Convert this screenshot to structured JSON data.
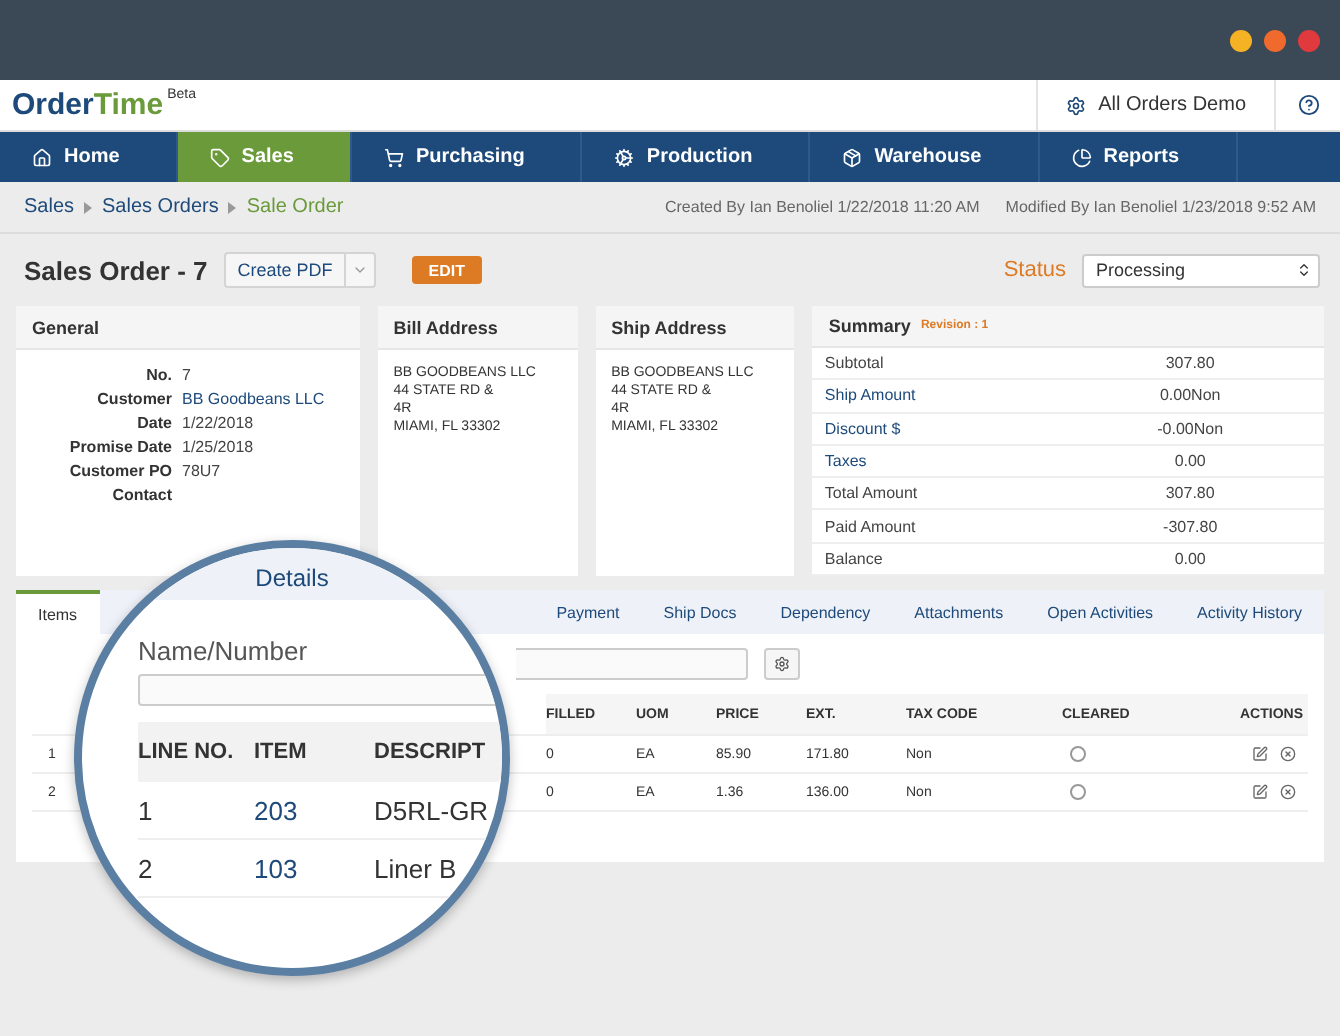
{
  "header": {
    "logo_prefix": "Order",
    "logo_suffix": "Time",
    "logo_badge": "Beta",
    "account": "All Orders Demo"
  },
  "nav": [
    {
      "label": "Home",
      "selected": false
    },
    {
      "label": "Sales",
      "selected": true
    },
    {
      "label": "Purchasing",
      "selected": false
    },
    {
      "label": "Production",
      "selected": false
    },
    {
      "label": "Warehouse",
      "selected": false
    },
    {
      "label": "Reports",
      "selected": false
    }
  ],
  "breadcrumb": [
    "Sales",
    "Sales Orders",
    "Sale Order"
  ],
  "created": "Created By Ian Benoliel 1/22/2018 11:20 AM",
  "modified": "Modified By Ian Benoliel 1/23/2018 9:52 AM",
  "title": "Sales Order - 7",
  "create_pdf": "Create PDF",
  "edit": "EDIT",
  "status_label": "Status",
  "status_value": "Processing",
  "general": {
    "title": "General",
    "fields": [
      {
        "label": "No.",
        "value": "7",
        "kind": "text"
      },
      {
        "label": "Customer",
        "value": "BB Goodbeans LLC",
        "kind": "link"
      },
      {
        "label": "Date",
        "value": "1/22/2018",
        "kind": "text"
      },
      {
        "label": "Promise Date",
        "value": "1/25/2018",
        "kind": "text"
      },
      {
        "label": "Customer PO",
        "value": "78U7",
        "kind": "text"
      },
      {
        "label": "Contact"
      }
    ]
  },
  "bill_address": {
    "title": "Bill Address",
    "lines": [
      "BB GOODBEANS LLC",
      "44 STATE RD &",
      "4R",
      "MIAMI, FL 33302"
    ]
  },
  "ship_address": {
    "title": "Ship Address",
    "lines": [
      "BB GOODBEANS LLC",
      "44 STATE RD &",
      "4R",
      "MIAMI, FL 33302"
    ]
  },
  "summary": {
    "title": "Summary",
    "revision": "Revision : 1",
    "rows": [
      {
        "label": "Subtotal",
        "value": "307.80",
        "link": false
      },
      {
        "label": "Ship Amount",
        "value": "0.00Non",
        "link": true
      },
      {
        "label": "Discount $",
        "value": "-0.00Non",
        "link": true
      },
      {
        "label": "Taxes",
        "value": "0.00",
        "link": true
      },
      {
        "label": "Total Amount",
        "value": "307.80",
        "link": false
      },
      {
        "label": "Paid Amount",
        "value": "-307.80",
        "link": false
      },
      {
        "label": "Balance",
        "value": "0.00",
        "link": false
      }
    ]
  },
  "item_tabs": [
    {
      "label": "Items",
      "selected": true
    },
    {
      "label": "Payment",
      "selected": false
    },
    {
      "label": "Ship Docs",
      "selected": false
    },
    {
      "label": "Dependency",
      "selected": false
    },
    {
      "label": "Attachments",
      "selected": false
    },
    {
      "label": "Open Activities",
      "selected": false
    },
    {
      "label": "Activity History",
      "selected": false
    }
  ],
  "table": {
    "columns": [
      "FILLED",
      "UOM",
      "PRICE",
      "EXT.",
      "TAX CODE",
      "CLEARED",
      "ACTIONS"
    ],
    "rows": [
      {
        "line": "1",
        "filled": "0",
        "uom": "EA",
        "price": "85.90",
        "ext": "171.80",
        "tax_code": "Non",
        "cleared": false
      },
      {
        "line": "2",
        "filled": "0",
        "uom": "EA",
        "price": "1.36",
        "ext": "136.00",
        "tax_code": "Non",
        "cleared": false
      }
    ]
  },
  "magnifier": {
    "tab": "Details",
    "field_label": "Name/Number",
    "columns": [
      "LINE NO.",
      "ITEM",
      "DESCRIPT"
    ],
    "rows": [
      {
        "line": "1",
        "item": "203",
        "description": "D5RL-GR"
      },
      {
        "line": "2",
        "item": "103",
        "description": "Liner B"
      }
    ]
  }
}
